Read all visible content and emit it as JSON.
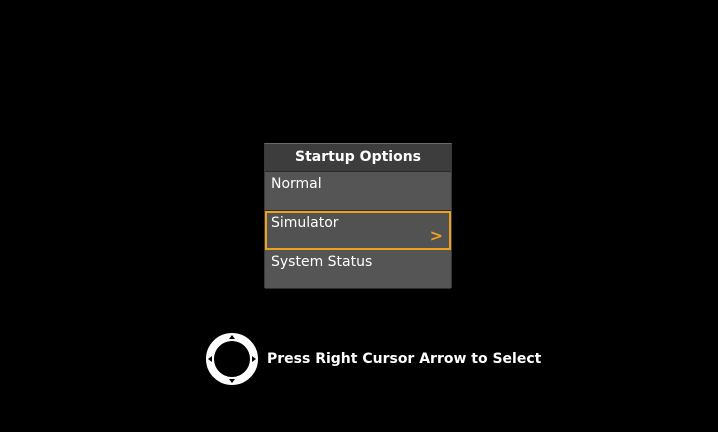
{
  "menu": {
    "title": "Startup Options",
    "items": [
      {
        "label": "Normal",
        "selected": false
      },
      {
        "label": "Simulator",
        "selected": true,
        "chevron": ">"
      },
      {
        "label": "System Status",
        "selected": false
      }
    ]
  },
  "hint": {
    "text": "Press Right Cursor Arrow to Select",
    "icon": "dpad-cursor-icon"
  },
  "colors": {
    "background": "#000000",
    "highlight": "#f0a020",
    "panel": "#4a4a4a",
    "text": "#ffffff"
  }
}
